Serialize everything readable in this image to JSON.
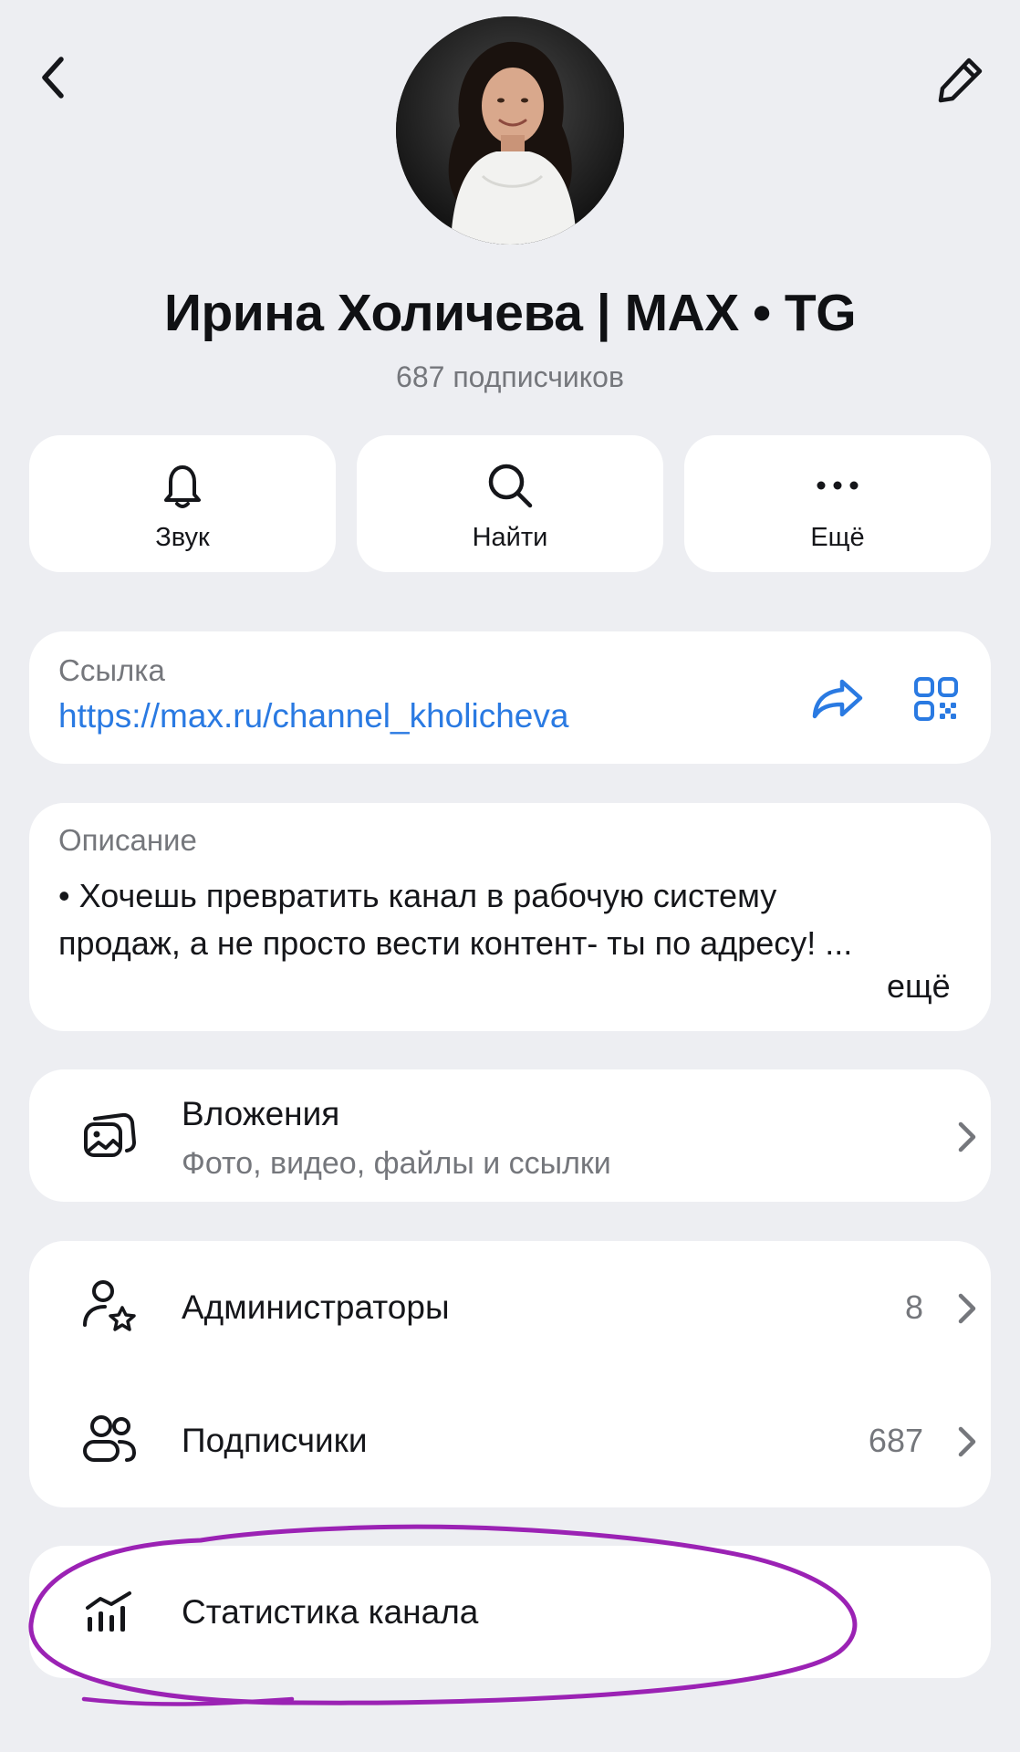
{
  "header": {
    "back_icon": "chevron-left-icon",
    "edit_icon": "pencil-icon",
    "title": "Ирина Холичева | MAX • TG",
    "subscribers": "687 подписчиков"
  },
  "actions": [
    {
      "label": "Звук",
      "icon": "bell-icon"
    },
    {
      "label": "Найти",
      "icon": "search-icon"
    },
    {
      "label": "Ещё",
      "icon": "more-icon"
    }
  ],
  "link": {
    "label": "Ссылка",
    "url": "https://max.ru/channel_kholicheva",
    "share_icon": "share-icon",
    "qr_icon": "qr-code-icon"
  },
  "description": {
    "label": "Описание",
    "text": "• Хочешь превратить канал в рабочую систему продаж, а не просто вести контент- ты по адресу! ...",
    "more": "ещё"
  },
  "attachments": {
    "title": "Вложения",
    "subtitle": "Фото, видео, файлы и ссылки",
    "icon": "gallery-icon"
  },
  "members": {
    "admins": {
      "label": "Администраторы",
      "count": "8",
      "icon": "admin-star-icon"
    },
    "subscribers": {
      "label": "Подписчики",
      "count": "687",
      "icon": "people-icon"
    }
  },
  "stats": {
    "label": "Статистика канала",
    "icon": "bar-chart-icon"
  },
  "colors": {
    "background": "#edeef2",
    "card": "#ffffff",
    "link": "#2a7ae2",
    "secondary_text": "#75777c",
    "annotation": "#9b22b4"
  }
}
